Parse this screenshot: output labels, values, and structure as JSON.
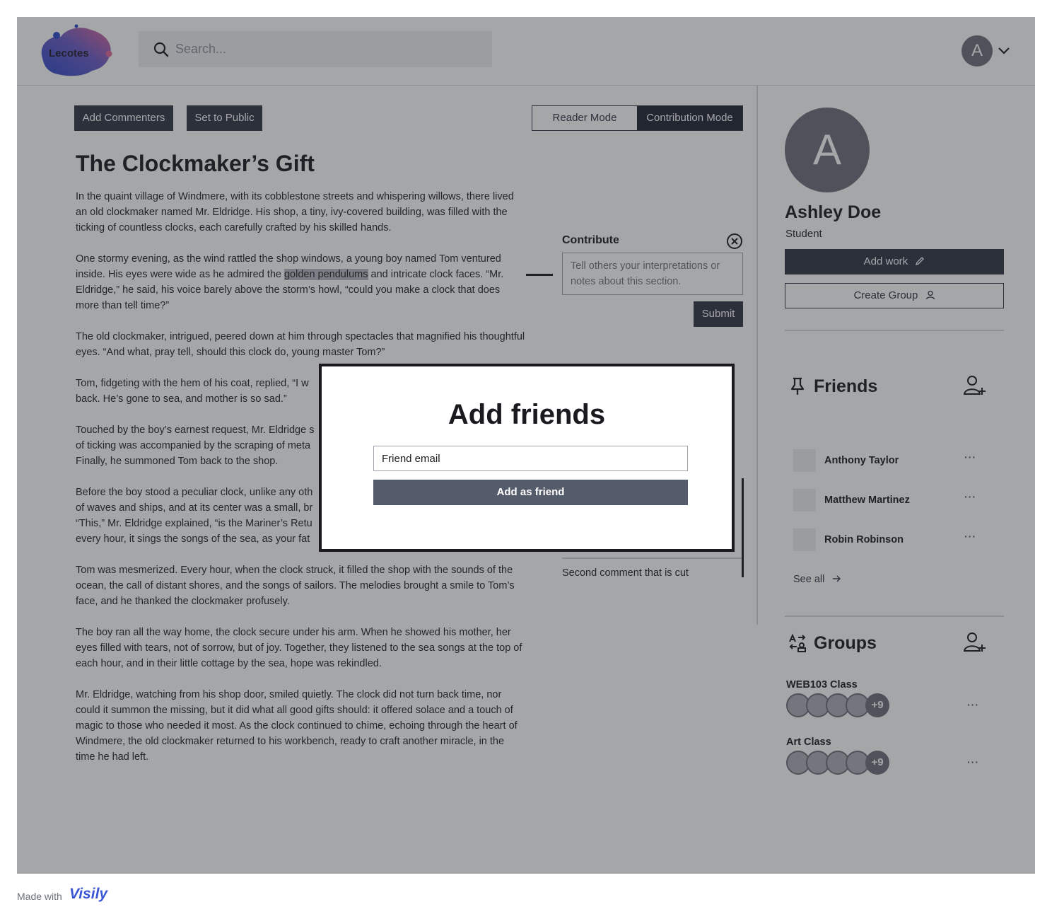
{
  "app": {
    "logo_text": "Lecotes"
  },
  "search": {
    "placeholder": "Search..."
  },
  "user_menu": {
    "initial": "A"
  },
  "toolbar": {
    "add_commenters": "Add Commenters",
    "set_public": "Set to Public",
    "reader_mode": "Reader Mode",
    "contribution_mode": "Contribution Mode",
    "active_mode": "Contribution Mode"
  },
  "story": {
    "title": "The Clockmaker’s Gift",
    "highlight": "golden pendulums",
    "paragraphs": [
      "In the quaint village of Windmere, with its cobblestone streets and whispering willows, there lived an old clockmaker named Mr. Eldridge. His shop, a tiny, ivy-covered building, was filled with the ticking of countless clocks, each carefully crafted by his skilled hands.",
      "One stormy evening, as the wind rattled the shop windows, a young boy named Tom ventured inside. His eyes were wide as he admired the",
      "and intricate clock faces. “Mr. Eldridge,” he said, his voice barely above the storm’s howl, “could you make a clock that does more than tell time?”",
      "The old clockmaker, intrigued, peered down at him through spectacles that magnified his thoughtful eyes. “And what, pray tell, should this clock do, young master Tom?”",
      "Tom, fidgeting with the hem of his coat, replied, “I w",
      "back. He’s gone to sea, and mother is so sad.”",
      "Touched by the boy’s earnest request, Mr. Eldridge s",
      "of ticking was accompanied by the scraping of meta",
      "Finally, he summoned Tom back to the shop.",
      "Before the boy stood a peculiar clock, unlike any oth",
      "of waves and ships, and at its center was a small, br",
      "“This,” Mr. Eldridge explained, “is the Mariner’s Retu",
      "every hour, it sings the songs of the sea, as your fat",
      "Tom was mesmerized. Every hour, when the clock struck, it filled the shop with the sounds of the ocean, the call of distant shores, and the songs of sailors. The melodies brought a smile to Tom’s face, and he thanked the clockmaker profusely.",
      "The boy ran all the way home, the clock secure under his arm. When he showed his mother, her eyes filled with tears, not of sorrow, but of joy. Together, they listened to the sea songs at the top of each hour, and in their little cottage by the sea, hope was rekindled.",
      "Mr. Eldridge, watching from his shop door, smiled quietly. The clock did not turn back time, nor could it summon the missing, but it did what all good gifts should: it offered solace and a touch of magic to those who needed it most. As the clock continued to chime, echoing through the heart of Windmere, the old clockmaker returned to his workbench, ready to craft another miracle, in the time he had left."
    ]
  },
  "contribute": {
    "heading": "Contribute",
    "placeholder": "Tell others your interpretations or notes about this section.",
    "submit": "Submit"
  },
  "comments": {
    "second": "Second comment that is cut"
  },
  "profile": {
    "initial": "A",
    "name": "Ashley Doe",
    "role": "Student",
    "add_work": "Add work",
    "create_group": "Create Group"
  },
  "friends": {
    "title": "Friends",
    "items": [
      {
        "name": "Anthony Taylor",
        "more": "···"
      },
      {
        "name": "Matthew Martinez",
        "more": "···"
      },
      {
        "name": "Robin Robinson",
        "more": "···"
      }
    ],
    "see_all": "See all"
  },
  "groups": {
    "title": "Groups",
    "items": [
      {
        "name": "WEB103 Class",
        "extra": "+9",
        "more": "···"
      },
      {
        "name": "Art Class",
        "extra": "+9",
        "more": "···"
      }
    ]
  },
  "modal": {
    "title": "Add friends",
    "email_value": "Friend email",
    "add_button": "Add as friend"
  },
  "footer": {
    "made_with": "Made with",
    "brand": "Visily"
  },
  "colors": {
    "primary_dark": "#2d3444",
    "modal_button": "#545b6b",
    "avatar": "#6b6f79",
    "brand": "#3a55d6"
  }
}
